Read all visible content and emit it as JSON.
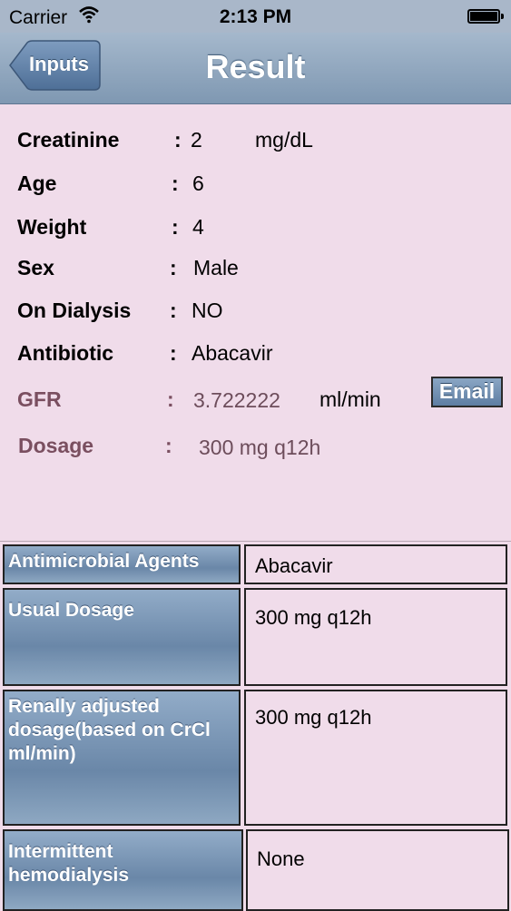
{
  "status_bar": {
    "carrier": "Carrier",
    "time": "2:13 PM"
  },
  "nav": {
    "back_label": "Inputs",
    "title": "Result"
  },
  "fields": {
    "creatinine": {
      "label": "Creatinine",
      "value": "2",
      "unit": "mg/dL"
    },
    "age": {
      "label": "Age",
      "value": "6"
    },
    "weight": {
      "label": "Weight",
      "value": "4"
    },
    "sex": {
      "label": "Sex",
      "value": "Male"
    },
    "dialysis": {
      "label": "On Dialysis",
      "value": "NO"
    },
    "antibiotic": {
      "label": "Antibiotic",
      "value": "Abacavir"
    },
    "gfr": {
      "label": "GFR",
      "value": "3.722222",
      "unit": "ml/min"
    },
    "dosage": {
      "label": "Dosage",
      "value": "300 mg q12h"
    },
    "colon": ":"
  },
  "email_label": "Email",
  "table": {
    "rows": [
      {
        "label": "Antimicrobial Agents",
        "value": "Abacavir"
      },
      {
        "label": "Usual Dosage",
        "value": "300 mg q12h"
      },
      {
        "label": "Renally adjusted dosage(based on CrCl ml/min)",
        "value": "300 mg q12h"
      },
      {
        "label": "Intermittent hemodialysis",
        "value": "None"
      }
    ]
  },
  "colors": {
    "background": "#f0dcea",
    "nav_blue": "#7f98b2",
    "muted_label": "#7a4f60"
  },
  "icons": [
    "wifi-icon",
    "battery-icon",
    "back-arrow-icon"
  ]
}
